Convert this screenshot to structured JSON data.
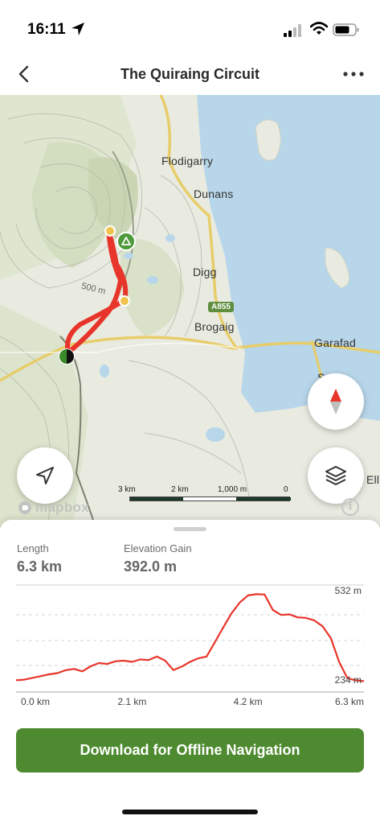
{
  "status_bar": {
    "time": "16:11"
  },
  "header": {
    "title": "The Quiraing Circuit"
  },
  "map": {
    "places": [
      "Flodigarry",
      "Dunans",
      "Digg",
      "Brogaig",
      "Garafad",
      "S",
      "Ell"
    ],
    "road_badge": "A855",
    "contour_label": "500 m",
    "scale": {
      "labels": [
        "3 km",
        "2 km",
        "1,000 m",
        "0"
      ]
    },
    "attribution": "mapbox",
    "info": "i"
  },
  "stats": {
    "length_label": "Length",
    "length_value": "6.3 km",
    "elevation_label": "Elevation Gain",
    "elevation_value": "392.0 m"
  },
  "chart_data": {
    "type": "line",
    "title": "",
    "xlabel": "",
    "ylabel": "",
    "x_ticks": [
      "0.0 km",
      "2.1 km",
      "4.2 km",
      "6.3 km"
    ],
    "y_ticks": [
      "532 m",
      "234 m"
    ],
    "xlim": [
      0,
      6.3
    ],
    "ylim": [
      220,
      540
    ],
    "grid": true,
    "series": [
      {
        "color": "#e8352b",
        "x": [
          0.0,
          0.15,
          0.3,
          0.45,
          0.6,
          0.75,
          0.9,
          1.05,
          1.2,
          1.35,
          1.5,
          1.65,
          1.8,
          1.95,
          2.1,
          2.25,
          2.4,
          2.55,
          2.7,
          2.85,
          3.0,
          3.15,
          3.3,
          3.45,
          3.6,
          3.75,
          3.9,
          4.05,
          4.2,
          4.35,
          4.5,
          4.65,
          4.8,
          4.95,
          5.1,
          5.25,
          5.4,
          5.55,
          5.7,
          5.85,
          6.0,
          6.15,
          6.3
        ],
        "y": [
          238,
          240,
          246,
          252,
          258,
          262,
          272,
          276,
          268,
          285,
          296,
          293,
          302,
          304,
          300,
          308,
          306,
          318,
          304,
          272,
          284,
          300,
          312,
          318,
          366,
          415,
          463,
          500,
          524,
          528,
          527,
          475,
          458,
          460,
          450,
          448,
          440,
          420,
          380,
          300,
          245,
          238,
          235
        ]
      }
    ]
  },
  "action": {
    "download_label": "Download for Offline Navigation"
  },
  "colors": {
    "accent": "#4e8a2f",
    "trail": "#e8352b",
    "water": "#b9d7ea"
  },
  "icons": [
    "back-chevron-icon",
    "more-icon",
    "location-arrow-icon",
    "compass-icon",
    "layers-icon",
    "signal-icon",
    "wifi-icon",
    "battery-icon",
    "mapbox-logo-icon",
    "campsite-icon"
  ]
}
